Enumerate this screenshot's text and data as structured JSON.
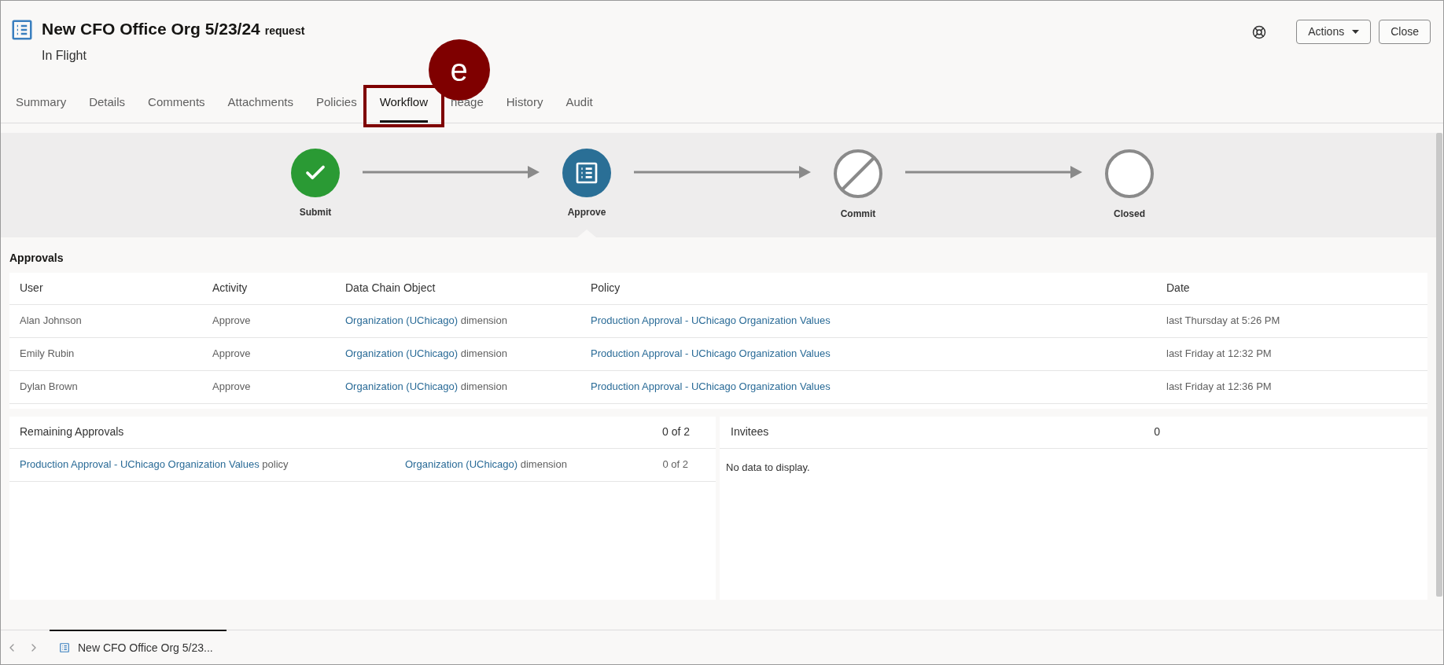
{
  "header": {
    "title": "New CFO Office Org 5/23/24",
    "title_suffix": "request",
    "status": "In Flight",
    "buttons": [
      {
        "label": "Actions",
        "kind": "menu"
      },
      {
        "label": "Close",
        "kind": "plain"
      }
    ]
  },
  "tabs": [
    {
      "label": "Summary",
      "selected": false
    },
    {
      "label": "Details",
      "selected": false
    },
    {
      "label": "Comments",
      "selected": false
    },
    {
      "label": "Attachments",
      "selected": false
    },
    {
      "label": "Policies",
      "selected": false
    },
    {
      "label": "Workflow",
      "selected": true,
      "callout": "e"
    },
    {
      "label": "neage",
      "selected": false
    },
    {
      "label": "History",
      "selected": false
    },
    {
      "label": "Audit",
      "selected": false
    }
  ],
  "workflow": [
    {
      "label": "Submit",
      "kind": "done"
    },
    {
      "label": "Approve",
      "kind": "current"
    },
    {
      "label": "Commit",
      "kind": "skipped"
    },
    {
      "label": "Closed",
      "kind": "pending"
    }
  ],
  "approvals": {
    "title": "Approvals",
    "columns": [
      "User",
      "Activity",
      "Data Chain Object",
      "Policy",
      "Date"
    ],
    "rows": [
      {
        "user": "Alan Johnson",
        "activity": "Approve",
        "object": {
          "link": "Organization (UChicago)",
          "suffix": "dimension"
        },
        "policy": "Production Approval - UChicago Organization Values",
        "date": "last Thursday at 5:26 PM"
      },
      {
        "user": "Emily Rubin",
        "activity": "Approve",
        "object": {
          "link": "Organization (UChicago)",
          "suffix": "dimension"
        },
        "policy": "Production Approval - UChicago Organization Values",
        "date": "last Friday at 12:32 PM"
      },
      {
        "user": "Dylan Brown",
        "activity": "Approve",
        "object": {
          "link": "Organization (UChicago)",
          "suffix": "dimension"
        },
        "policy": "Production Approval - UChicago Organization Values",
        "date": "last Friday at 12:36 PM"
      }
    ]
  },
  "remaining": {
    "title": "Remaining Approvals",
    "count": "0 of 2",
    "rows": [
      {
        "policy": {
          "link": "Production Approval - UChicago Organization Values",
          "suffix": "policy"
        },
        "object": {
          "link": "Organization (UChicago)",
          "suffix": "dimension"
        },
        "count": "0 of 2"
      }
    ]
  },
  "invitees": {
    "title": "Invitees",
    "count": "0",
    "empty": "No data to display."
  },
  "footer": {
    "tab": "New CFO Office Org 5/23..."
  }
}
